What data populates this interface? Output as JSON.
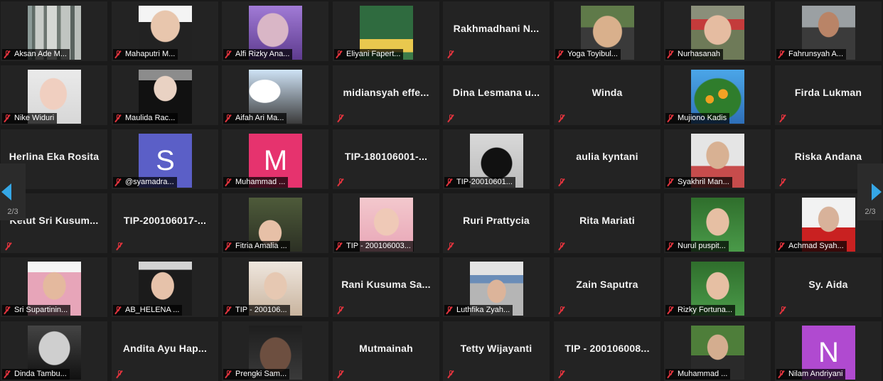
{
  "navigation": {
    "left_page": "2/3",
    "right_page": "2/3",
    "arrow_color": "#35a7e6"
  },
  "participants": [
    {
      "name": "Aksan Ade M...",
      "style": "video",
      "photo": "ph-forest"
    },
    {
      "name": "Mahaputri M...",
      "style": "video",
      "photo": "ph-girl1"
    },
    {
      "name": "Alfi Rizky Ana...",
      "style": "video",
      "photo": "ph-purple"
    },
    {
      "name": "Eliyani Fapert...",
      "style": "video",
      "photo": "ph-sign"
    },
    {
      "name": "Rakhmadhani N...",
      "style": "name"
    },
    {
      "name": "Yoga Toyibul...",
      "style": "video",
      "photo": "ph-man-hat"
    },
    {
      "name": "Nurhasanah",
      "style": "video",
      "photo": "ph-woman-red"
    },
    {
      "name": "Fahrunsyah A...",
      "style": "video",
      "photo": "ph-man-cliff"
    },
    {
      "name": "Nike Widuri",
      "style": "video",
      "photo": "ph-hijab-white"
    },
    {
      "name": "Maulida Rac...",
      "style": "video",
      "photo": "ph-hijab-black"
    },
    {
      "name": "Aifah Ari Ma...",
      "style": "video",
      "photo": "ph-sky"
    },
    {
      "name": "midiansyah effe...",
      "style": "name"
    },
    {
      "name": "Dina Lesmana u...",
      "style": "name"
    },
    {
      "name": "Winda",
      "style": "name"
    },
    {
      "name": "Mujiono Kadis",
      "style": "video",
      "photo": "ph-tree"
    },
    {
      "name": "Firda Lukman",
      "style": "name"
    },
    {
      "name": "Herlina Eka Rosita",
      "style": "name"
    },
    {
      "name": "@syamadra...",
      "style": "initial",
      "letter": "S",
      "color": "#5b5fc7"
    },
    {
      "name": "Muhammad ...",
      "style": "initial",
      "letter": "M",
      "color": "#e6336e"
    },
    {
      "name": "TIP-180106001-...",
      "style": "name"
    },
    {
      "name": "TIP-20010601...",
      "style": "video",
      "photo": "ph-niqab"
    },
    {
      "name": "aulia kyntani",
      "style": "name"
    },
    {
      "name": "Syakhril Man...",
      "style": "video",
      "photo": "ph-man-shirt"
    },
    {
      "name": "Riska Andana",
      "style": "name"
    },
    {
      "name": "Ketut Sri Kusum...",
      "style": "name"
    },
    {
      "name": "TIP-200106017-...",
      "style": "name"
    },
    {
      "name": "Fitria Amalia ...",
      "style": "video",
      "photo": "ph-fairylights"
    },
    {
      "name": "TIP - 200106003...",
      "style": "video",
      "photo": "ph-pink",
      "wide_label": true
    },
    {
      "name": "Ruri Prattycia",
      "style": "name"
    },
    {
      "name": "Rita Mariati",
      "style": "name"
    },
    {
      "name": "Nurul puspit...",
      "style": "video",
      "photo": "ph-green-hijab"
    },
    {
      "name": "Achmad Syah...",
      "style": "video",
      "photo": "ph-red-jacket"
    },
    {
      "name": "Sri Supartinin...",
      "style": "video",
      "photo": "ph-pink-hijab"
    },
    {
      "name": "AB_HELENA ...",
      "style": "video",
      "photo": "ph-dark-hair"
    },
    {
      "name": "TIP - 200106...",
      "style": "video",
      "photo": "ph-beige-hijab"
    },
    {
      "name": "Rani Kusuma Sa...",
      "style": "name"
    },
    {
      "name": "Luthfika Zyah...",
      "style": "video",
      "photo": "ph-street"
    },
    {
      "name": "Zain Saputra",
      "style": "name"
    },
    {
      "name": "Rizky Fortuna...",
      "style": "video",
      "photo": "ph-green-hijab"
    },
    {
      "name": "Sy. Aida",
      "style": "name"
    },
    {
      "name": "Dinda Tambu...",
      "style": "video",
      "photo": "ph-einstein"
    },
    {
      "name": "Andita Ayu Hap...",
      "style": "name"
    },
    {
      "name": "Prengki Sam...",
      "style": "video",
      "photo": "ph-dark-selfie"
    },
    {
      "name": "Mutmainah",
      "style": "name"
    },
    {
      "name": "Tetty Wijayanti",
      "style": "name"
    },
    {
      "name": "TIP - 200106008...",
      "style": "name"
    },
    {
      "name": "Muhammad ...",
      "style": "video",
      "photo": "ph-green-outdoor"
    },
    {
      "name": "Nilam Andriyani",
      "style": "initial",
      "letter": "N",
      "color": "#b04ad0"
    }
  ]
}
